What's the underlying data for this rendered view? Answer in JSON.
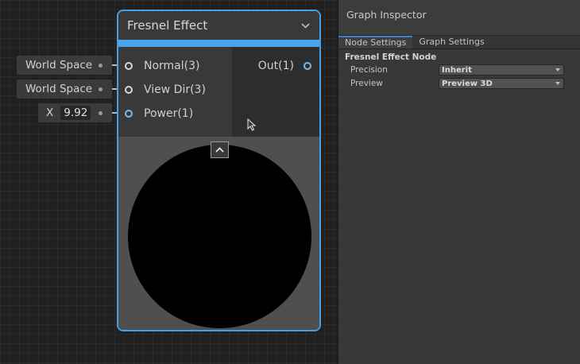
{
  "inputs": {
    "normal_chip": "World Space",
    "viewdir_chip": "World Space",
    "power_axis": "X",
    "power_value": "9.92"
  },
  "node": {
    "title": "Fresnel Effect",
    "inputs": [
      "Normal(3)",
      "View Dir(3)",
      "Power(1)"
    ],
    "output": "Out(1)",
    "accent_color": "#49a6ee"
  },
  "icons": {
    "collapse": "chevron-down-icon",
    "preview_toggle": "chevron-up-icon",
    "cursor": "mouse-cursor-icon"
  },
  "inspector": {
    "title": "Graph Inspector",
    "tabs": [
      "Node Settings",
      "Graph Settings"
    ],
    "active_tab": "Node Settings",
    "section_title": "Fresnel Effect Node",
    "properties": [
      {
        "label": "Precision",
        "value": "Inherit"
      },
      {
        "label": "Preview",
        "value": "Preview 3D"
      }
    ]
  }
}
